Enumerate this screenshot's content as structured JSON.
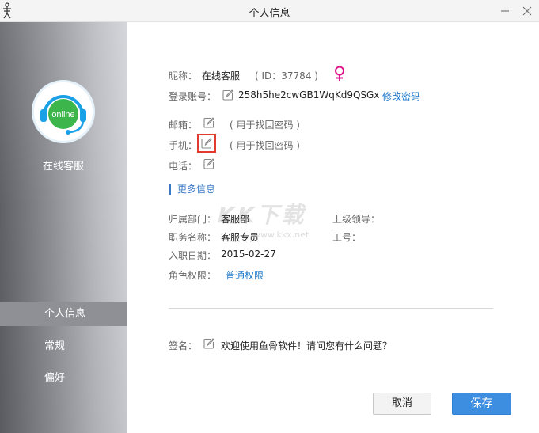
{
  "window": {
    "title": "个人信息"
  },
  "sidebar": {
    "avatar_text": "online",
    "user_name": "在线客服",
    "items": [
      {
        "label": "个人信息",
        "active": true
      },
      {
        "label": "常规",
        "active": false
      },
      {
        "label": "偏好",
        "active": false
      }
    ]
  },
  "profile": {
    "nickname_label": "昵称：",
    "nickname": "在线客服",
    "id_text": "( ID：37784 )",
    "gender_icon": "female-icon",
    "account_label": "登录账号：",
    "account": "258h5he2cwGB1WqKd9QSGx",
    "change_password": "修改密码",
    "email_label": "邮箱：",
    "email_hint": "( 用于找回密码 )",
    "phone_label": "手机：",
    "phone_hint": "( 用于找回密码 )",
    "tel_label": "电话："
  },
  "more_info": {
    "title": "更多信息",
    "department_label": "归属部门：",
    "department": "客服部",
    "supervisor_label": "上级领导：",
    "position_label": "职务名称：",
    "position": "客服专员",
    "employee_no_label": "工号：",
    "hire_date_label": "入职日期：",
    "hire_date": "2015-02-27",
    "role_label": "角色权限：",
    "role": "普通权限"
  },
  "signature": {
    "label": "签名：",
    "text": "欢迎使用鱼骨软件！请问您有什么问题？"
  },
  "buttons": {
    "cancel": "取消",
    "save": "保存"
  },
  "watermark": {
    "text": "KK下载",
    "sub": "www.kkx.net"
  },
  "colors": {
    "accent": "#3d8ee0",
    "link": "#1e78c8",
    "gender": "#e0148c",
    "highlight_box": "#e23a2f",
    "avatar_ring": "#1aa0e6",
    "avatar_badge": "#3cb54a"
  }
}
